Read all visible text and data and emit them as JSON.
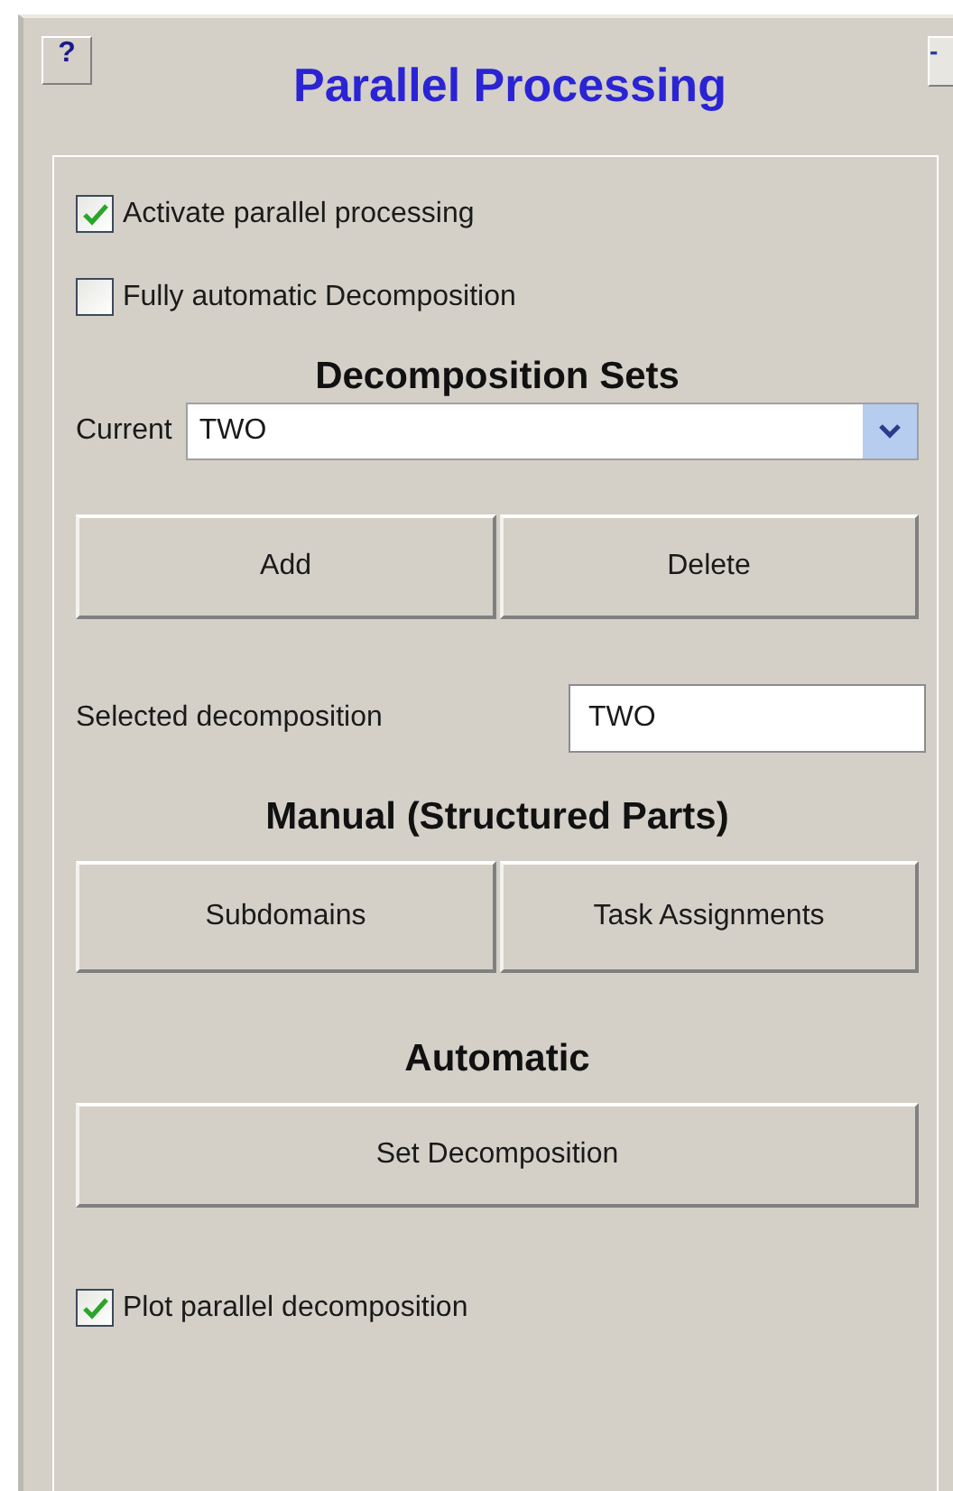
{
  "header": {
    "help_button": "?",
    "title": "Parallel Processing",
    "minimize_button": "-"
  },
  "options": [
    {
      "label": "Activate parallel processing",
      "checked": true
    },
    {
      "label": "Fully automatic Decomposition",
      "checked": false
    }
  ],
  "decomposition_sets": {
    "heading": "Decomposition Sets",
    "current_label": "Current",
    "current_value": "TWO",
    "buttons": [
      "Add",
      "Delete"
    ],
    "selected_label": "Selected decomposition",
    "selected_value": "TWO"
  },
  "manual": {
    "heading": "Manual (Structured Parts)",
    "buttons": [
      "Subdomains",
      "Task Assignments"
    ]
  },
  "automatic": {
    "heading": "Automatic",
    "buttons": [
      "Set Decomposition"
    ]
  },
  "plot_option": {
    "label": "Plot parallel decomposition",
    "checked": true
  }
}
